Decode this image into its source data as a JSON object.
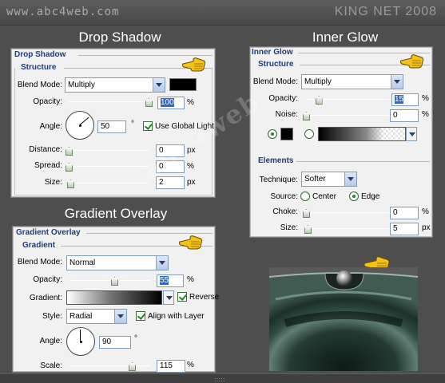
{
  "header": {
    "site_url": "www.abc4web.com",
    "brand": "KING NET 2008"
  },
  "drop_shadow": {
    "section_title": "Drop Shadow",
    "panel_title": "Drop Shadow",
    "group_title": "Structure",
    "blend_mode": {
      "label": "Blend Mode:",
      "value": "Multiply",
      "color": "#000000"
    },
    "opacity": {
      "label": "Opacity:",
      "value": "100",
      "unit": "%",
      "slider_fraction": 1.0
    },
    "angle": {
      "label": "Angle:",
      "value": "50",
      "unit": "°",
      "degrees": 50,
      "global_light_label": "Use Global Light",
      "global_light_checked": true
    },
    "distance": {
      "label": "Distance:",
      "value": "0",
      "unit": "px",
      "slider_fraction": 0.0
    },
    "spread": {
      "label": "Spread:",
      "value": "0",
      "unit": "%",
      "slider_fraction": 0.0
    },
    "size": {
      "label": "Size:",
      "value": "2",
      "unit": "px",
      "slider_fraction": 0.01
    }
  },
  "inner_glow": {
    "section_title": "Inner Glow",
    "panel_title": "Inner Glow",
    "structure_title": "Structure",
    "blend_mode": {
      "label": "Blend Mode:",
      "value": "Multiply"
    },
    "opacity": {
      "label": "Opacity:",
      "value": "15",
      "unit": "%",
      "slider_fraction": 0.15
    },
    "noise": {
      "label": "Noise:",
      "value": "0",
      "unit": "%",
      "slider_fraction": 0.0
    },
    "color": "#000000",
    "elements_title": "Elements",
    "technique": {
      "label": "Technique:",
      "value": "Softer"
    },
    "source": {
      "label": "Source:",
      "options": [
        "Center",
        "Edge"
      ],
      "selected": "Edge"
    },
    "choke": {
      "label": "Choke:",
      "value": "0",
      "unit": "%",
      "slider_fraction": 0.0
    },
    "size": {
      "label": "Size:",
      "value": "5",
      "unit": "px",
      "slider_fraction": 0.02
    }
  },
  "gradient_overlay": {
    "section_title": "Gradient Overlay",
    "panel_title": "Gradient Overlay",
    "group_title": "Gradient",
    "blend_mode": {
      "label": "Blend Mode:",
      "value": "Normal"
    },
    "opacity": {
      "label": "Opacity:",
      "value": "55",
      "unit": "%",
      "slider_fraction": 0.55
    },
    "gradient": {
      "label": "Gradient:",
      "reverse_label": "Reverse",
      "reverse_checked": true
    },
    "style": {
      "label": "Style:",
      "value": "Radial",
      "align_label": "Align with Layer",
      "align_checked": true
    },
    "angle": {
      "label": "Angle:",
      "value": "90",
      "unit": "°",
      "degrees": 90
    },
    "scale": {
      "label": "Scale:",
      "value": "115",
      "unit": "%",
      "slider_fraction": 0.77
    }
  },
  "watermark": {
    "text": "abc4web"
  },
  "colors": {
    "background": "#4e4e4e",
    "panel": "#f1f1f1",
    "title_blue": "#1e3c7a",
    "pointer_yellow": "#f2c21a"
  },
  "icons": [
    "pointing-hand-icon",
    "dropdown-arrow-icon",
    "checkbox-checked-icon",
    "radio-selected-icon",
    "slider-thumb-icon",
    "angle-dial-icon"
  ]
}
